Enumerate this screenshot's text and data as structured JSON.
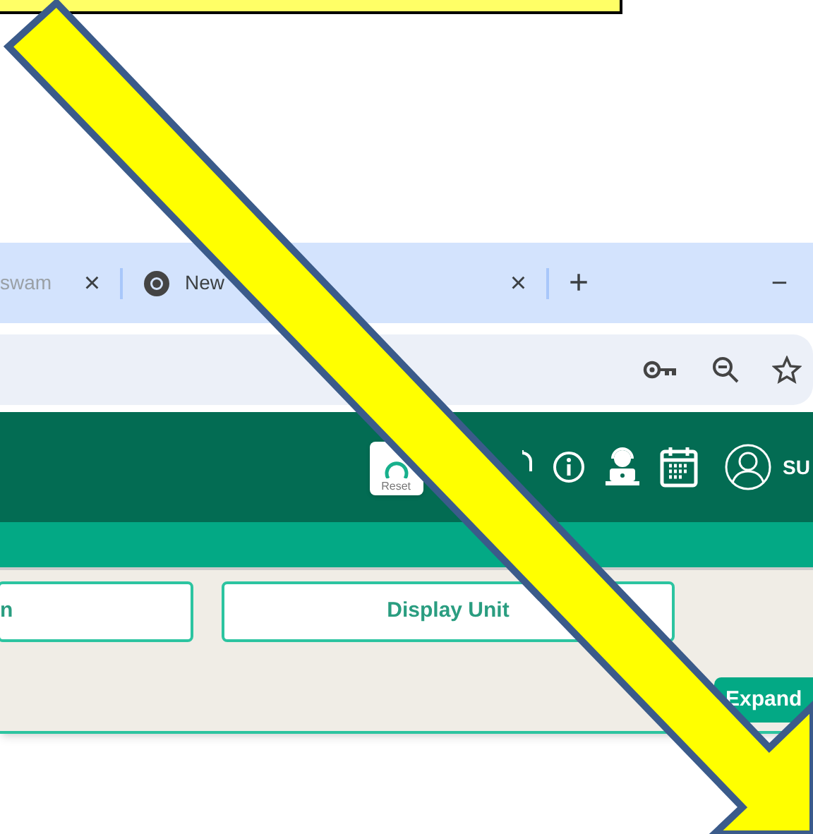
{
  "browser": {
    "tabs": [
      {
        "title": "swam",
        "close": "×"
      },
      {
        "title": "New",
        "close": "×"
      }
    ],
    "new_tab": "+",
    "minimize": "−"
  },
  "header": {
    "reset_label": "Reset",
    "user": "SU"
  },
  "buttons": [
    {
      "label": "n"
    },
    {
      "label": "Display Unit"
    }
  ],
  "expand_button": "Expand"
}
